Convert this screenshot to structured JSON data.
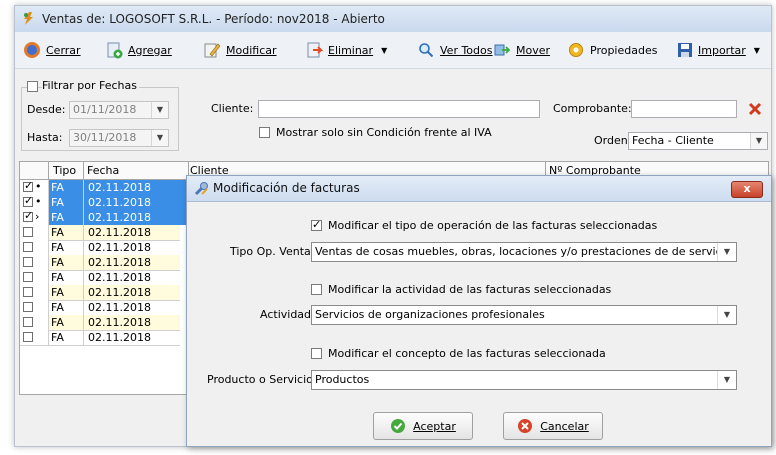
{
  "window": {
    "title": "Ventas de: LOGOSOFT S.R.L. - Período: nov2018 - Abierto"
  },
  "toolbar": {
    "cerrar": "Cerrar",
    "agregar": "Agregar",
    "modificar": "Modificar",
    "eliminar": "Eliminar",
    "ver_todos": "Ver Todos",
    "mover": "Mover",
    "propiedades": "Propiedades",
    "importar": "Importar"
  },
  "filter": {
    "filtrar_label": "Filtrar por Fechas",
    "desde_label": "Desde:",
    "desde_value": "01/11/2018",
    "hasta_label": "Hasta:",
    "hasta_value": "30/11/2018",
    "cliente_label": "Cliente:",
    "cliente_value": "",
    "mostrar_label": "Mostrar solo sin Condición frente al IVA",
    "comprobante_label": "Comprobante:",
    "comprobante_value": "",
    "orden_label": "Orden:",
    "orden_value": "Fecha - Cliente"
  },
  "grid": {
    "headers": {
      "tipo": "Tipo",
      "fecha": "Fecha",
      "cliente": "Cliente",
      "comprobante": "Nº Comprobante"
    },
    "rows": [
      {
        "tipo": "FA",
        "fecha": "02.11.2018",
        "checked": true,
        "marker": "•",
        "selected": true
      },
      {
        "tipo": "FA",
        "fecha": "02.11.2018",
        "checked": true,
        "marker": "•",
        "selected": true
      },
      {
        "tipo": "FA",
        "fecha": "02.11.2018",
        "checked": true,
        "marker": "›",
        "selected": true
      },
      {
        "tipo": "FA",
        "fecha": "02.11.2018",
        "checked": false,
        "marker": "",
        "selected": false
      },
      {
        "tipo": "FA",
        "fecha": "02.11.2018",
        "checked": false,
        "marker": "",
        "selected": false
      },
      {
        "tipo": "FA",
        "fecha": "02.11.2018",
        "checked": false,
        "marker": "",
        "selected": false
      },
      {
        "tipo": "FA",
        "fecha": "02.11.2018",
        "checked": false,
        "marker": "",
        "selected": false
      },
      {
        "tipo": "FA",
        "fecha": "02.11.2018",
        "checked": false,
        "marker": "",
        "selected": false
      },
      {
        "tipo": "FA",
        "fecha": "02.11.2018",
        "checked": false,
        "marker": "",
        "selected": false
      },
      {
        "tipo": "FA",
        "fecha": "02.11.2018",
        "checked": false,
        "marker": "",
        "selected": false
      },
      {
        "tipo": "FA",
        "fecha": "02.11.2018",
        "checked": false,
        "marker": "",
        "selected": false
      }
    ]
  },
  "dialog": {
    "title": "Modificación de facturas",
    "close": "x",
    "mod_tipo_label": "Modificar el tipo de operación de las facturas seleccionadas",
    "mod_tipo_checked": true,
    "tipo_op_label": "Tipo Op. Venta",
    "tipo_op_value": "Ventas de cosas muebles, obras, locaciones y/o prestaciones de de servicios",
    "mod_actividad_label": "Modificar la actividad de las facturas seleccionadas",
    "mod_actividad_checked": false,
    "actividad_label": "Actividad",
    "actividad_value": "Servicios de organizaciones profesionales",
    "mod_concepto_label": "Modificar el concepto de las facturas seleccionada",
    "mod_concepto_checked": false,
    "producto_label": "Producto o Servicio",
    "producto_value": "Productos",
    "aceptar": "Aceptar",
    "cancelar": "Cancelar"
  },
  "colors": {
    "selection": "#3a8ee6",
    "alt_row": "#fffbdc",
    "close_button": "#c8412b"
  }
}
